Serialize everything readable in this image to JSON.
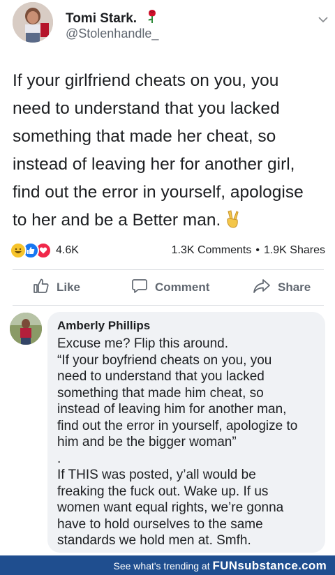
{
  "post": {
    "author_name": "Tomi Stark.",
    "author_handle": "@Stolenhandle_",
    "text_lines": [
      "If your girlfriend cheats on you, you",
      "need to understand that you lacked",
      "something that made her cheat, so",
      "instead of leaving her for another girl,",
      "find out the error in yourself, apologise",
      "to her and be a Better man."
    ],
    "reaction_count": "4.6K",
    "comments_count": "1.3K Comments",
    "separator": "•",
    "shares_count": "1.9K Shares",
    "actions": {
      "like": "Like",
      "comment": "Comment",
      "share": "Share"
    }
  },
  "comment": {
    "author_name": "Amberly Phillips",
    "text_lines": [
      "Excuse me? Flip this around.",
      "“If your boyfriend cheats on you, you",
      "need to understand that you lacked",
      "something that made him cheat, so",
      "instead of leaving him for another man,",
      "find out the error in yourself, apologize to",
      "him and be the bigger woman”",
      ".",
      "If THIS was posted, y’all would be",
      "freaking the fuck out. Wake up. If us",
      "women want equal rights, we’re gonna",
      "have to hold ourselves to the same",
      "standards we hold men at. Smfh."
    ]
  },
  "footer": {
    "text": "See what's trending at",
    "brand": "FUNsubstance.com"
  },
  "colors": {
    "footer_bg": "#1f4e8f",
    "like_blue": "#1877f2",
    "love_red": "#f0284a",
    "haha_yellow": "#f7c42c",
    "bubble_bg": "#f0f2f5",
    "secondary_text": "#606770"
  },
  "icons": {
    "rose": "rose-emoji",
    "victory": "victory-hand-emoji",
    "menu": "chevron-down-icon",
    "like": "thumbs-up-icon",
    "comment": "speech-bubble-icon",
    "share": "share-arrow-icon"
  }
}
